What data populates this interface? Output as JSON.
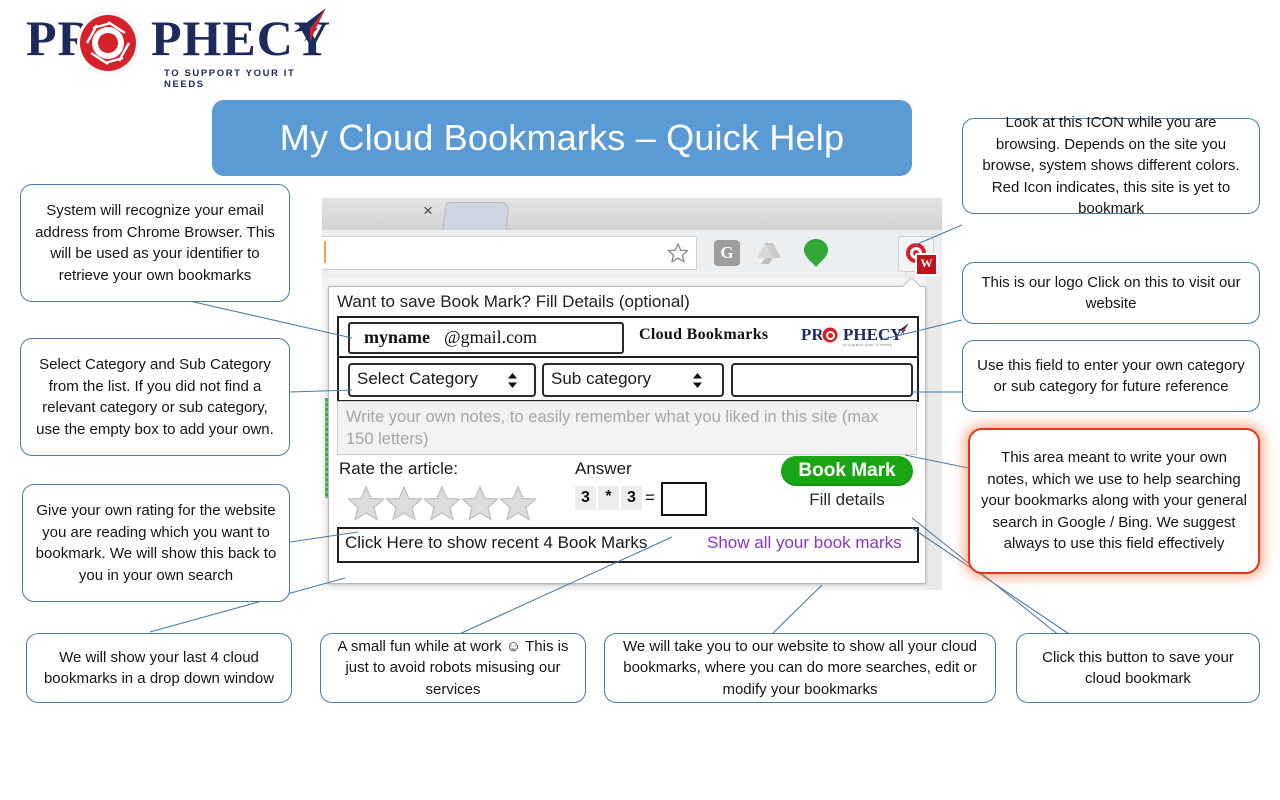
{
  "logo": {
    "word_part1": "PR",
    "word_part2": "PHECY",
    "tagline": "TO SUPPORT YOUR IT NEEDS"
  },
  "header": {
    "title": "My Cloud Bookmarks – Quick Help"
  },
  "browser": {
    "tab_close_glyph": "×",
    "toolbar_icons": {
      "bookmark_star": "star-icon",
      "g_extension": "G",
      "drive_extension": "drive-icon",
      "pin_extension": "pin-icon",
      "prophecy_extension_badge": "W"
    }
  },
  "popup": {
    "title": "Want to save Book Mark? Fill Details (optional)",
    "email": {
      "user": "myname",
      "domain": "@gmail.com"
    },
    "brand_label": "Cloud Bookmarks",
    "mini_logo": {
      "part1": "PR",
      "part2": "PHECY",
      "tagline": "to support your it needs"
    },
    "category_select": "Select Category",
    "subcategory_select": "Sub category",
    "own_category_value": "",
    "notes_placeholder": "Write your own notes, to easily remember what you liked in this site (max 150 letters)",
    "rate_label": "Rate the article:",
    "stars": 5,
    "answer_label": "Answer",
    "captcha": {
      "num1": "3",
      "operator": "*",
      "num2": "3",
      "equals": "=",
      "value": ""
    },
    "bookmark_button": "Book Mark",
    "fill_details": "Fill details",
    "recent_link": "Click Here to show recent 4 Book Marks",
    "show_all_link": "Show all your book marks"
  },
  "callouts": {
    "email_recognize": "System will recognize your email address from Chrome Browser. This will be used as your identifier to retrieve your own bookmarks",
    "category_select": "Select Category and Sub Category from the list. If you did not find a relevant category or sub category, use the empty box to add your own.",
    "rating": "Give your own rating for the website you are reading which you want to bookmark. We will show this back to you in your own search",
    "recent_bookmarks": "We will show your last 4 cloud bookmarks in a drop down window",
    "captcha": "A small fun while at work ☺ This is just to avoid robots misusing our services",
    "show_all": "We will take you to our website to show all your cloud bookmarks, where you can do more searches, edit or modify your bookmarks",
    "save_button": "Click this button to save your cloud bookmark",
    "icon_colors": "Look at this ICON while you are browsing. Depends on the site you browse, system shows different colors. Red Icon indicates, this site is yet to bookmark",
    "logo_link": "This is our logo Click on this to visit our website",
    "own_field": "Use this field to enter your own category or sub category for future reference",
    "notes_area": "This area meant to write your own notes, which we use to help searching your bookmarks along with your general search in Google / Bing. We suggest always to use this field effectively"
  },
  "colors": {
    "banner_blue": "#5b9bd5",
    "callout_border": "#4a7ba6",
    "highlight_red": "#e8341c",
    "brand_red": "#d6202a",
    "brand_navy": "#1d2a5c",
    "button_green": "#1aa515",
    "link_purple": "#8b35c4"
  }
}
